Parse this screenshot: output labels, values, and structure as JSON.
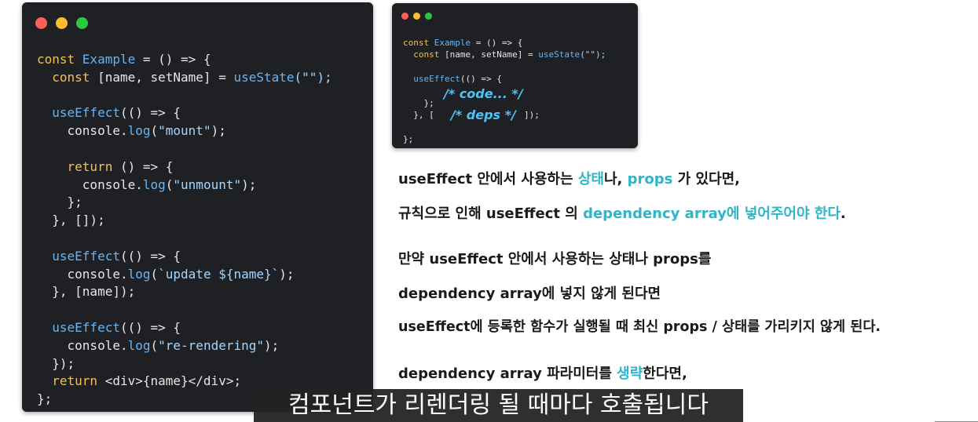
{
  "left_code": {
    "l1": {
      "a": "const ",
      "b": "Example",
      "c": " = () => {"
    },
    "l2": {
      "a": "  const ",
      "b": "[name, setName] = ",
      "c": "useState",
      "d": "(\"\");"
    },
    "l4": {
      "a": "  ",
      "b": "useEffect",
      "c": "(() => {"
    },
    "l5": {
      "a": "    console.",
      "b": "log",
      "c": "(",
      "d": "\"mount\"",
      "e": ");"
    },
    "l7": {
      "a": "    ",
      "b": "return",
      "c": " () => {"
    },
    "l8": {
      "a": "      console.",
      "b": "log",
      "c": "(",
      "d": "\"unmount\"",
      "e": ");"
    },
    "l9": "    };",
    "l10": "  }, []);",
    "l12": {
      "a": "  ",
      "b": "useEffect",
      "c": "(() => {"
    },
    "l13": {
      "a": "    console.",
      "b": "log",
      "c": "(",
      "d": "`update ${name}`",
      "e": ");"
    },
    "l14": "  }, [name]);",
    "l16": {
      "a": "  ",
      "b": "useEffect",
      "c": "(() => {"
    },
    "l17": {
      "a": "    console.",
      "b": "log",
      "c": "(",
      "d": "\"re-rendering\"",
      "e": ");"
    },
    "l18": "  });",
    "l19": {
      "a": "  ",
      "b": "return",
      "c": " <div>{name}</div>;"
    },
    "l20": "};"
  },
  "right_code": {
    "l1": {
      "a": "const ",
      "b": "Example",
      "c": " = () => {"
    },
    "l2": {
      "a": "  const ",
      "b": "[name, setName] = ",
      "c": "useState",
      "d": "(\"\");"
    },
    "l4": {
      "a": "  ",
      "b": "useEffect",
      "c": "(() => {"
    },
    "l5": "    };",
    "l6": "  }, [",
    "l6_tail": "]);",
    "l8": "};",
    "note_code": "/* code... */",
    "note_deps": "/* deps */"
  },
  "explanation": {
    "line1": {
      "a": "useEffect 안에서 사용하는 ",
      "b": "상태",
      "c": "나, ",
      "d": "props",
      "e": " 가 있다면,"
    },
    "line2": {
      "a": "규칙으로 인해 useEffect 의 ",
      "b": "dependency array에 넣어주어야 한다",
      "c": "."
    },
    "line3": "만약 useEffect 안에서 사용하는 상태나 props를",
    "line4": "dependency array에 넣지 않게 된다면",
    "line5": "useEffect에 등록한 함수가 실행될 때 최신 props / 상태를 가리키지 않게 된다.",
    "line6": {
      "a": "dependency array  파라미터를 ",
      "b": "생략",
      "c": "한다면,"
    }
  },
  "subtitle": "컴포넌트가 리렌더링 될 때마다 호출됩니다",
  "colors": {
    "highlight": "#2fb4c8",
    "keyword": "#f2c14e",
    "function": "#65b5f6",
    "string": "#a5d6ff"
  }
}
